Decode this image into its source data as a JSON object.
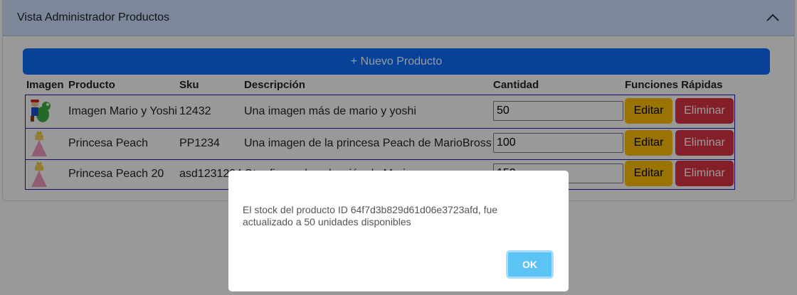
{
  "panel": {
    "title": "Vista Administrador Productos"
  },
  "toolbar": {
    "new_product_label": "+ Nuevo Producto"
  },
  "table": {
    "headers": {
      "image": "Imagen",
      "product": "Producto",
      "sku": "Sku",
      "description": "Descripción",
      "quantity": "Cantidad",
      "actions": "Funciones Rápidas"
    },
    "rows": [
      {
        "product": "Imagen Mario y Yoshi",
        "sku": "12432",
        "description": "Una imagen más de mario y yoshi",
        "quantity": "50",
        "edit_label": "Editar",
        "delete_label": "Eliminar",
        "image_icon": "mario-yoshi-icon"
      },
      {
        "product": "Princesa Peach",
        "sku": "PP1234",
        "description": "Una imagen de la princesa Peach de MarioBross",
        "quantity": "100",
        "edit_label": "Editar",
        "delete_label": "Eliminar",
        "image_icon": "peach-icon"
      },
      {
        "product": "Princesa Peach 20",
        "sku": "asd1231234",
        "description": "Otra figura de colección de Mario",
        "quantity": "150",
        "edit_label": "Editar",
        "delete_label": "Eliminar",
        "image_icon": "peach-icon"
      }
    ]
  },
  "dialog": {
    "message": "El stock del producto ID 64f7d3b829d61d06e3723afd, fue actualizado a 50 unidades disponibles",
    "ok_label": "OK"
  },
  "colors": {
    "primary": "#0d6efd",
    "warning": "#ffc107",
    "danger": "#dc3545",
    "header_bg": "#cfe2ff",
    "ok_button": "#5cc4f5"
  }
}
